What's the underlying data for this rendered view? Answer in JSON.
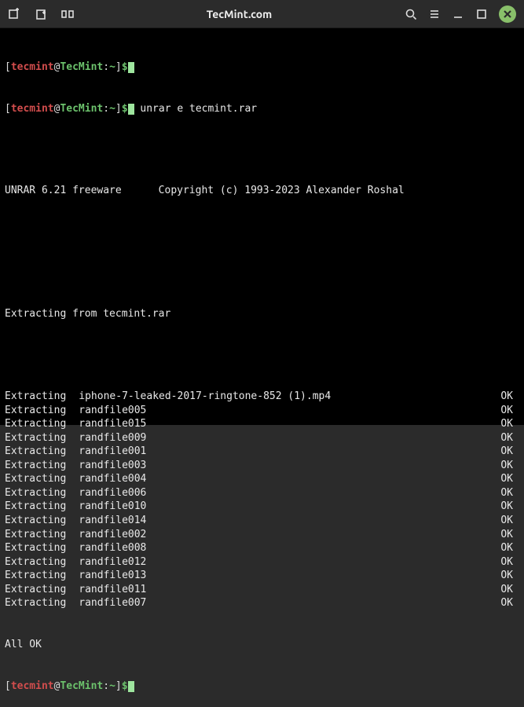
{
  "titlebar": {
    "title": "TecMint.com"
  },
  "prompt": {
    "user": "tecmint",
    "host": "TecMint",
    "path": "~",
    "bracket_open": "[",
    "bracket_close": "]",
    "at": "@",
    "colon": ":",
    "dollar": "$"
  },
  "command": "unrar e tecmint.rar",
  "version_line": "UNRAR 6.21 freeware      Copyright (c) 1993-2023 Alexander Roshal",
  "extracting_from": "Extracting from tecmint.rar",
  "extract_label": "Extracting",
  "ok_label": "OK",
  "all_ok": "All OK",
  "files": [
    "iphone-7-leaked-2017-ringtone-852 (1).mp4",
    "randfile005",
    "randfile015",
    "randfile009",
    "randfile001",
    "randfile003",
    "randfile004",
    "randfile006",
    "randfile010",
    "randfile014",
    "randfile002",
    "randfile008",
    "randfile012",
    "randfile013",
    "randfile011",
    "randfile007"
  ]
}
